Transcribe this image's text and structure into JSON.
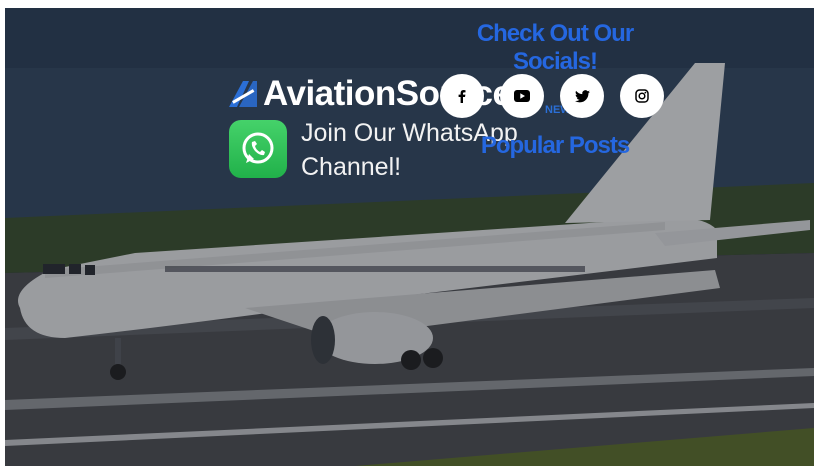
{
  "hero": {
    "brand_name": "AviationSource",
    "brand_suffix": "NEWS",
    "whatsapp_line1": "Join Our WhatsApp",
    "whatsapp_line2": "Channel!"
  },
  "socials": {
    "title": "Check Out Our Socials!",
    "items": [
      {
        "name": "facebook",
        "icon": "facebook-icon"
      },
      {
        "name": "youtube",
        "icon": "youtube-icon"
      },
      {
        "name": "twitter",
        "icon": "twitter-icon"
      },
      {
        "name": "instagram",
        "icon": "instagram-icon"
      }
    ]
  },
  "popular_posts": {
    "title": "Popular Posts"
  },
  "colors": {
    "accent_blue": "#2567e0",
    "whatsapp_green": "#25b84e",
    "icon_black": "#000000"
  }
}
